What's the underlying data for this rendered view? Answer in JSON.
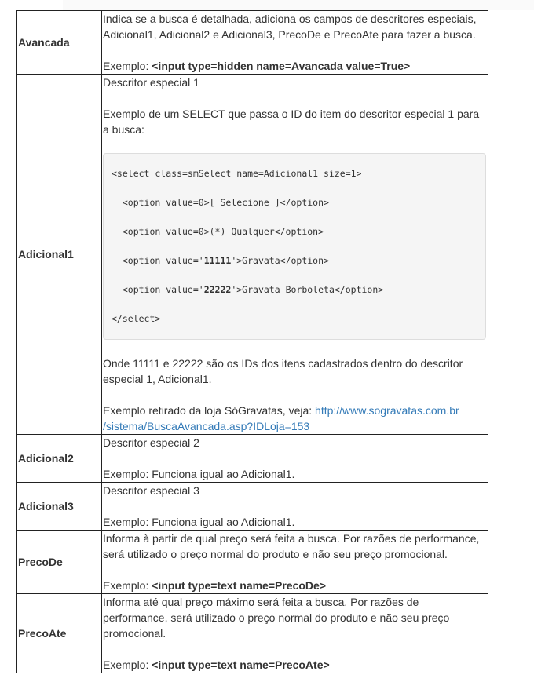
{
  "rows": [
    {
      "name": "Avancada",
      "desc": "Indica se a busca é detalhada, adiciona os campos de descritores especiais, Adicional1, Adicional2 e Adicional3, PrecoDe e PrecoAte para fazer a busca.",
      "example_prefix": "Exemplo: ",
      "example_code": "<input type=hidden name=Avancada value=True>"
    },
    {
      "name": "Adicional1",
      "desc": "Descritor especial 1",
      "select_intro": "Exemplo de um SELECT que passa o ID do item do descritor especial 1 para a busca:",
      "code": {
        "line1": "<select class=smSelect name=Adicional1 size=1>",
        "line2": "  <option value=0>[ Selecione ]</option>",
        "line3": "  <option value=0>(*) Qualquer</option>",
        "line4_pre": "  <option value='",
        "line4_bold": "11111",
        "line4_post": "'>Gravata</option>",
        "line5_pre": "  <option value='",
        "line5_bold": "22222",
        "line5_post": "'>Gravata Borboleta</option>",
        "line6": "</select>"
      },
      "ids_note": "Onde 11111 e 22222 são os IDs dos itens cadastrados dentro do descritor especial 1, Adicional1.",
      "source_prefix": "Exemplo retirado da loja SóGravatas, veja: ",
      "source_link_1": "http://www.sogravatas.com.br",
      "source_link_2": "/sistema/BuscaAvancada.asp?IDLoja=153"
    },
    {
      "name": "Adicional2",
      "desc": "Descritor especial 2",
      "example": "Exemplo: Funciona igual ao Adicional1."
    },
    {
      "name": "Adicional3",
      "desc": "Descritor especial 3",
      "example": "Exemplo: Funciona igual ao Adicional1."
    },
    {
      "name": "PrecoDe",
      "desc": "Informa à partir de qual preço será feita a busca. Por razões de performance, será utilizado o preço normal do produto e não seu preço promocional.",
      "example_prefix": "Exemplo: ",
      "example_code": "<input type=text name=PrecoDe>"
    },
    {
      "name": "PrecoAte",
      "desc": "Informa até qual preço máximo será feita a busca. Por razões de performance, será utilizado o preço normal do produto e não seu preço promocional.",
      "example_prefix": "Exemplo: ",
      "example_code": "<input type=text name=PrecoAte>"
    }
  ]
}
